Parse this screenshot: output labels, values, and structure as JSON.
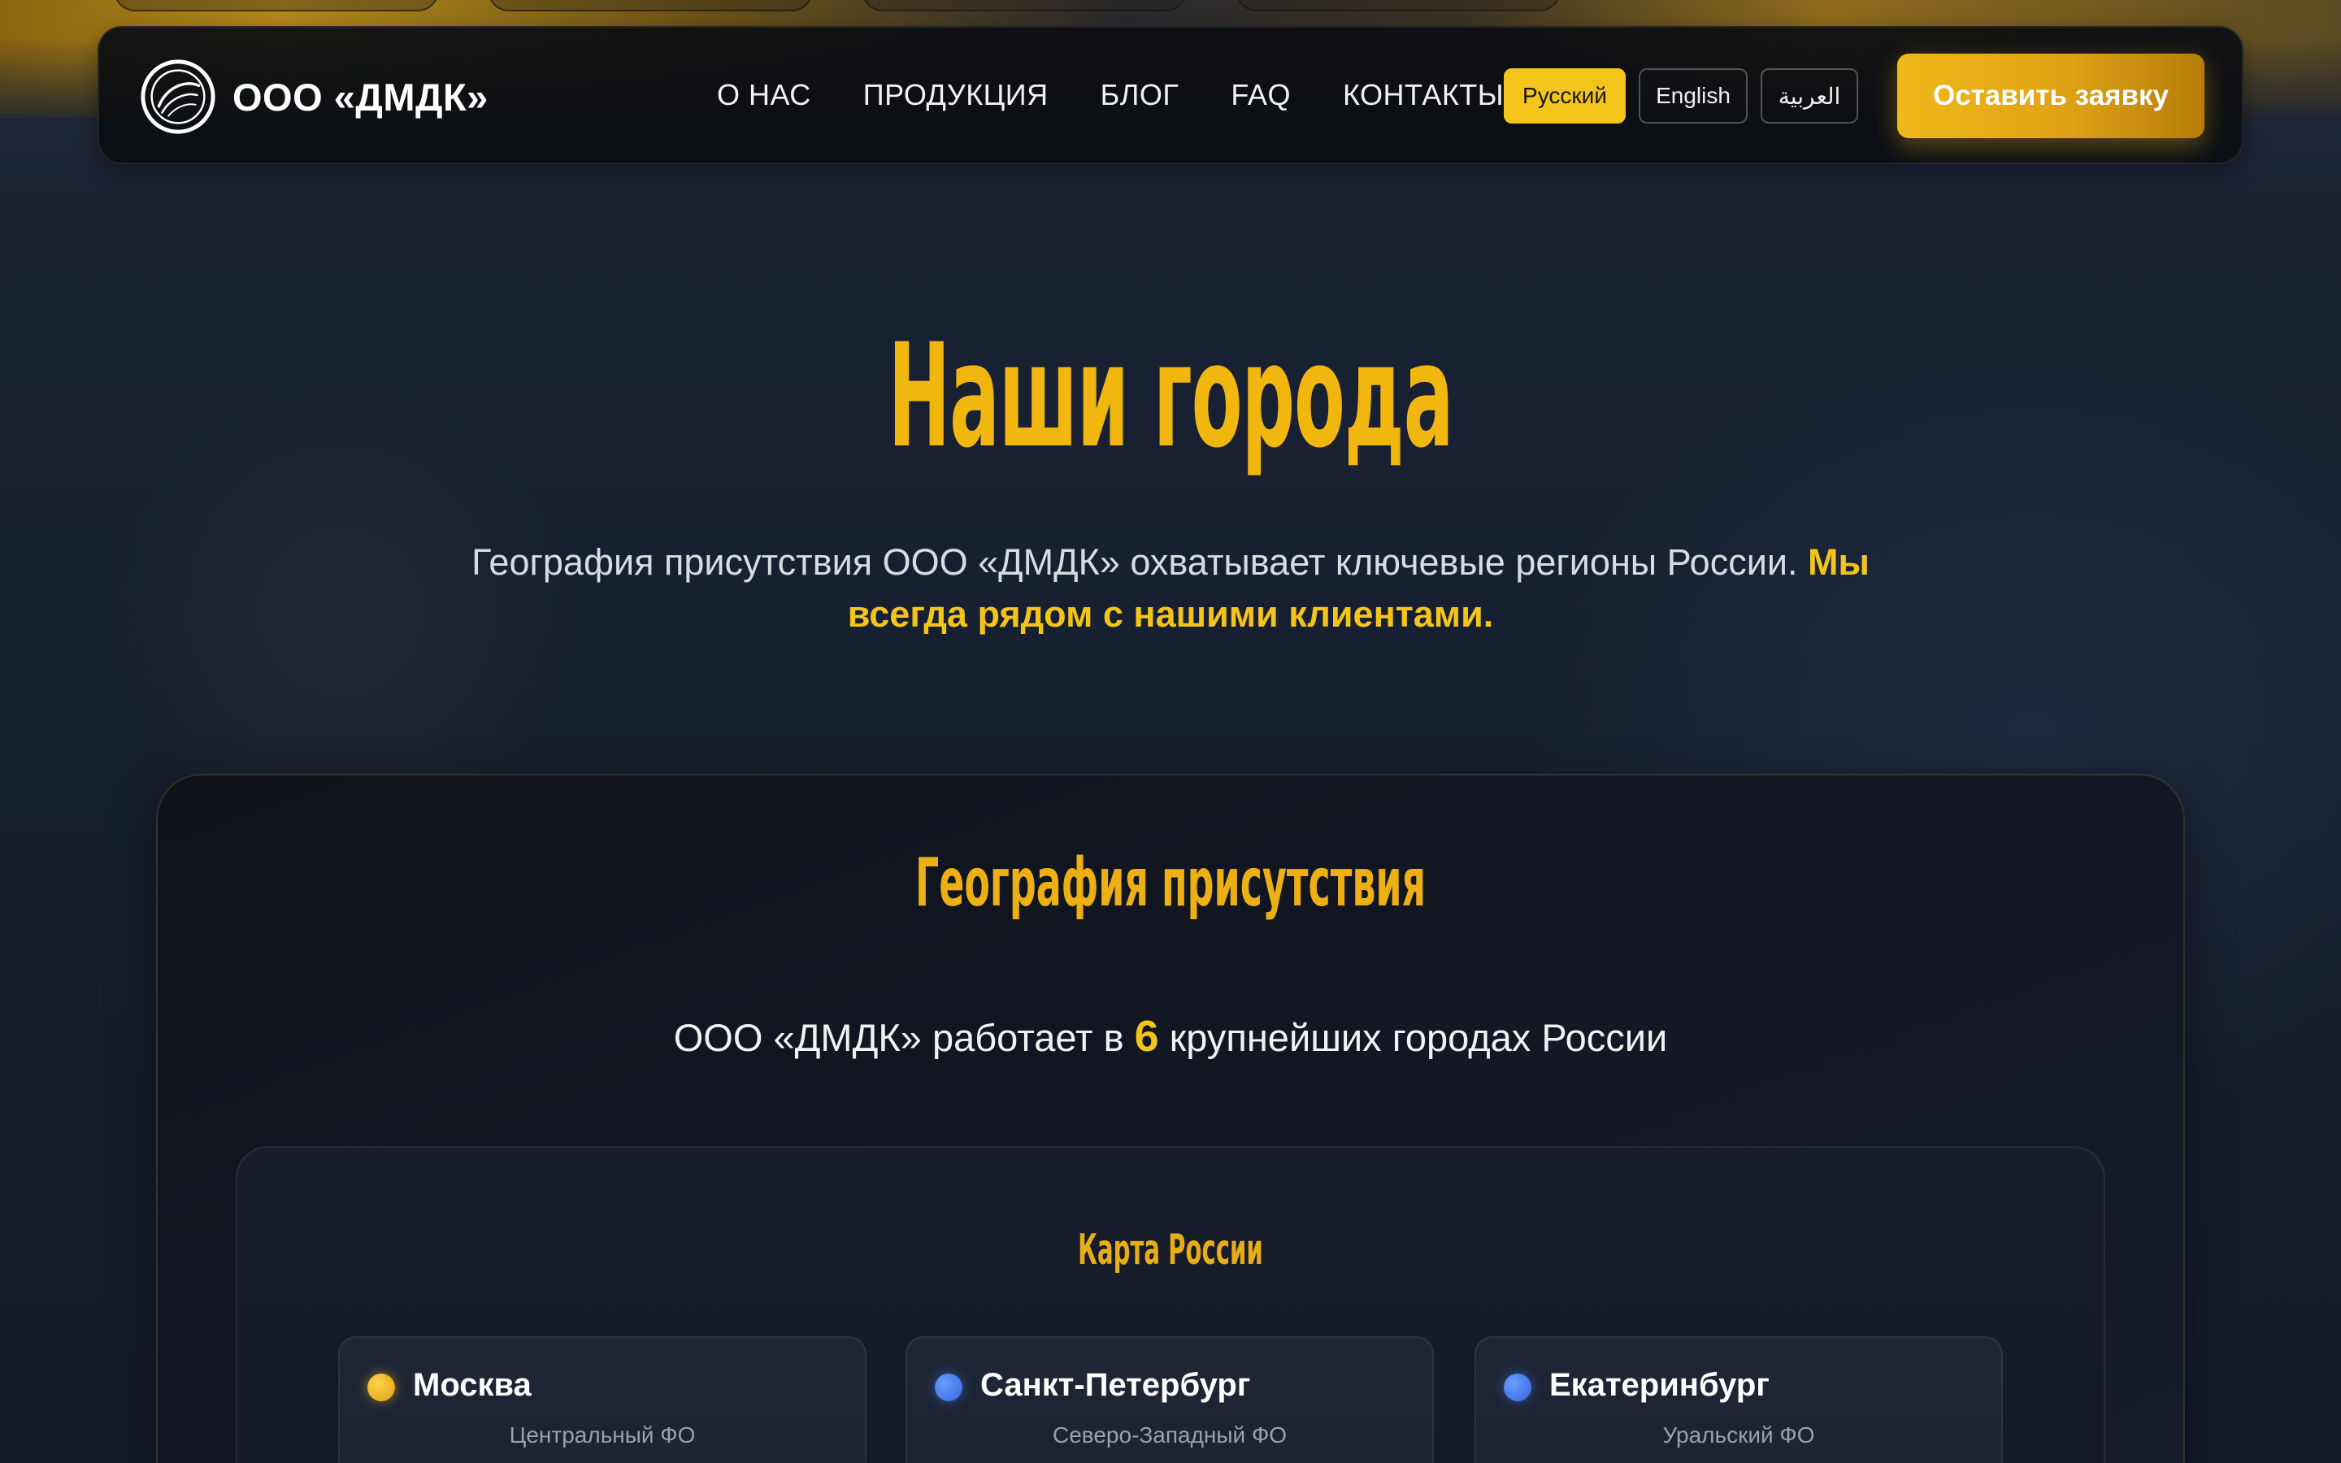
{
  "brand": {
    "name": "ООО «ДМДК»"
  },
  "nav": {
    "links": [
      "О НАС",
      "ПРОДУКЦИЯ",
      "БЛОГ",
      "FAQ",
      "КОНТАКТЫ"
    ],
    "languages": [
      "Русский",
      "English",
      "العربية"
    ],
    "active_language": "Русский",
    "cta_label": "Оставить заявку"
  },
  "hero": {
    "title": "Наши города",
    "lead_text": "География присутствия ООО «ДМДК» охватывает ключевые регионы России. ",
    "lead_highlight": "Мы всегда рядом с нашими клиентами."
  },
  "geography": {
    "title": "География присутствия",
    "subtitle_prefix": "ООО «ДМДК» работает в ",
    "city_count": "6",
    "subtitle_suffix": " крупнейших городах России",
    "map_title": "Карта России",
    "cities": [
      {
        "name": "Москва",
        "district": "Центральный ФО",
        "dot": "gold"
      },
      {
        "name": "Санкт-Петербург",
        "district": "Северо-Западный ФО",
        "dot": "blue"
      },
      {
        "name": "Екатеринбург",
        "district": "Уральский ФО",
        "dot": "blue"
      }
    ]
  },
  "colors": {
    "accent": "#f3c419",
    "background": "#141b2a",
    "navbar": "#0c0e12",
    "dot_gold": "#e0a012",
    "dot_blue": "#3466e0"
  }
}
